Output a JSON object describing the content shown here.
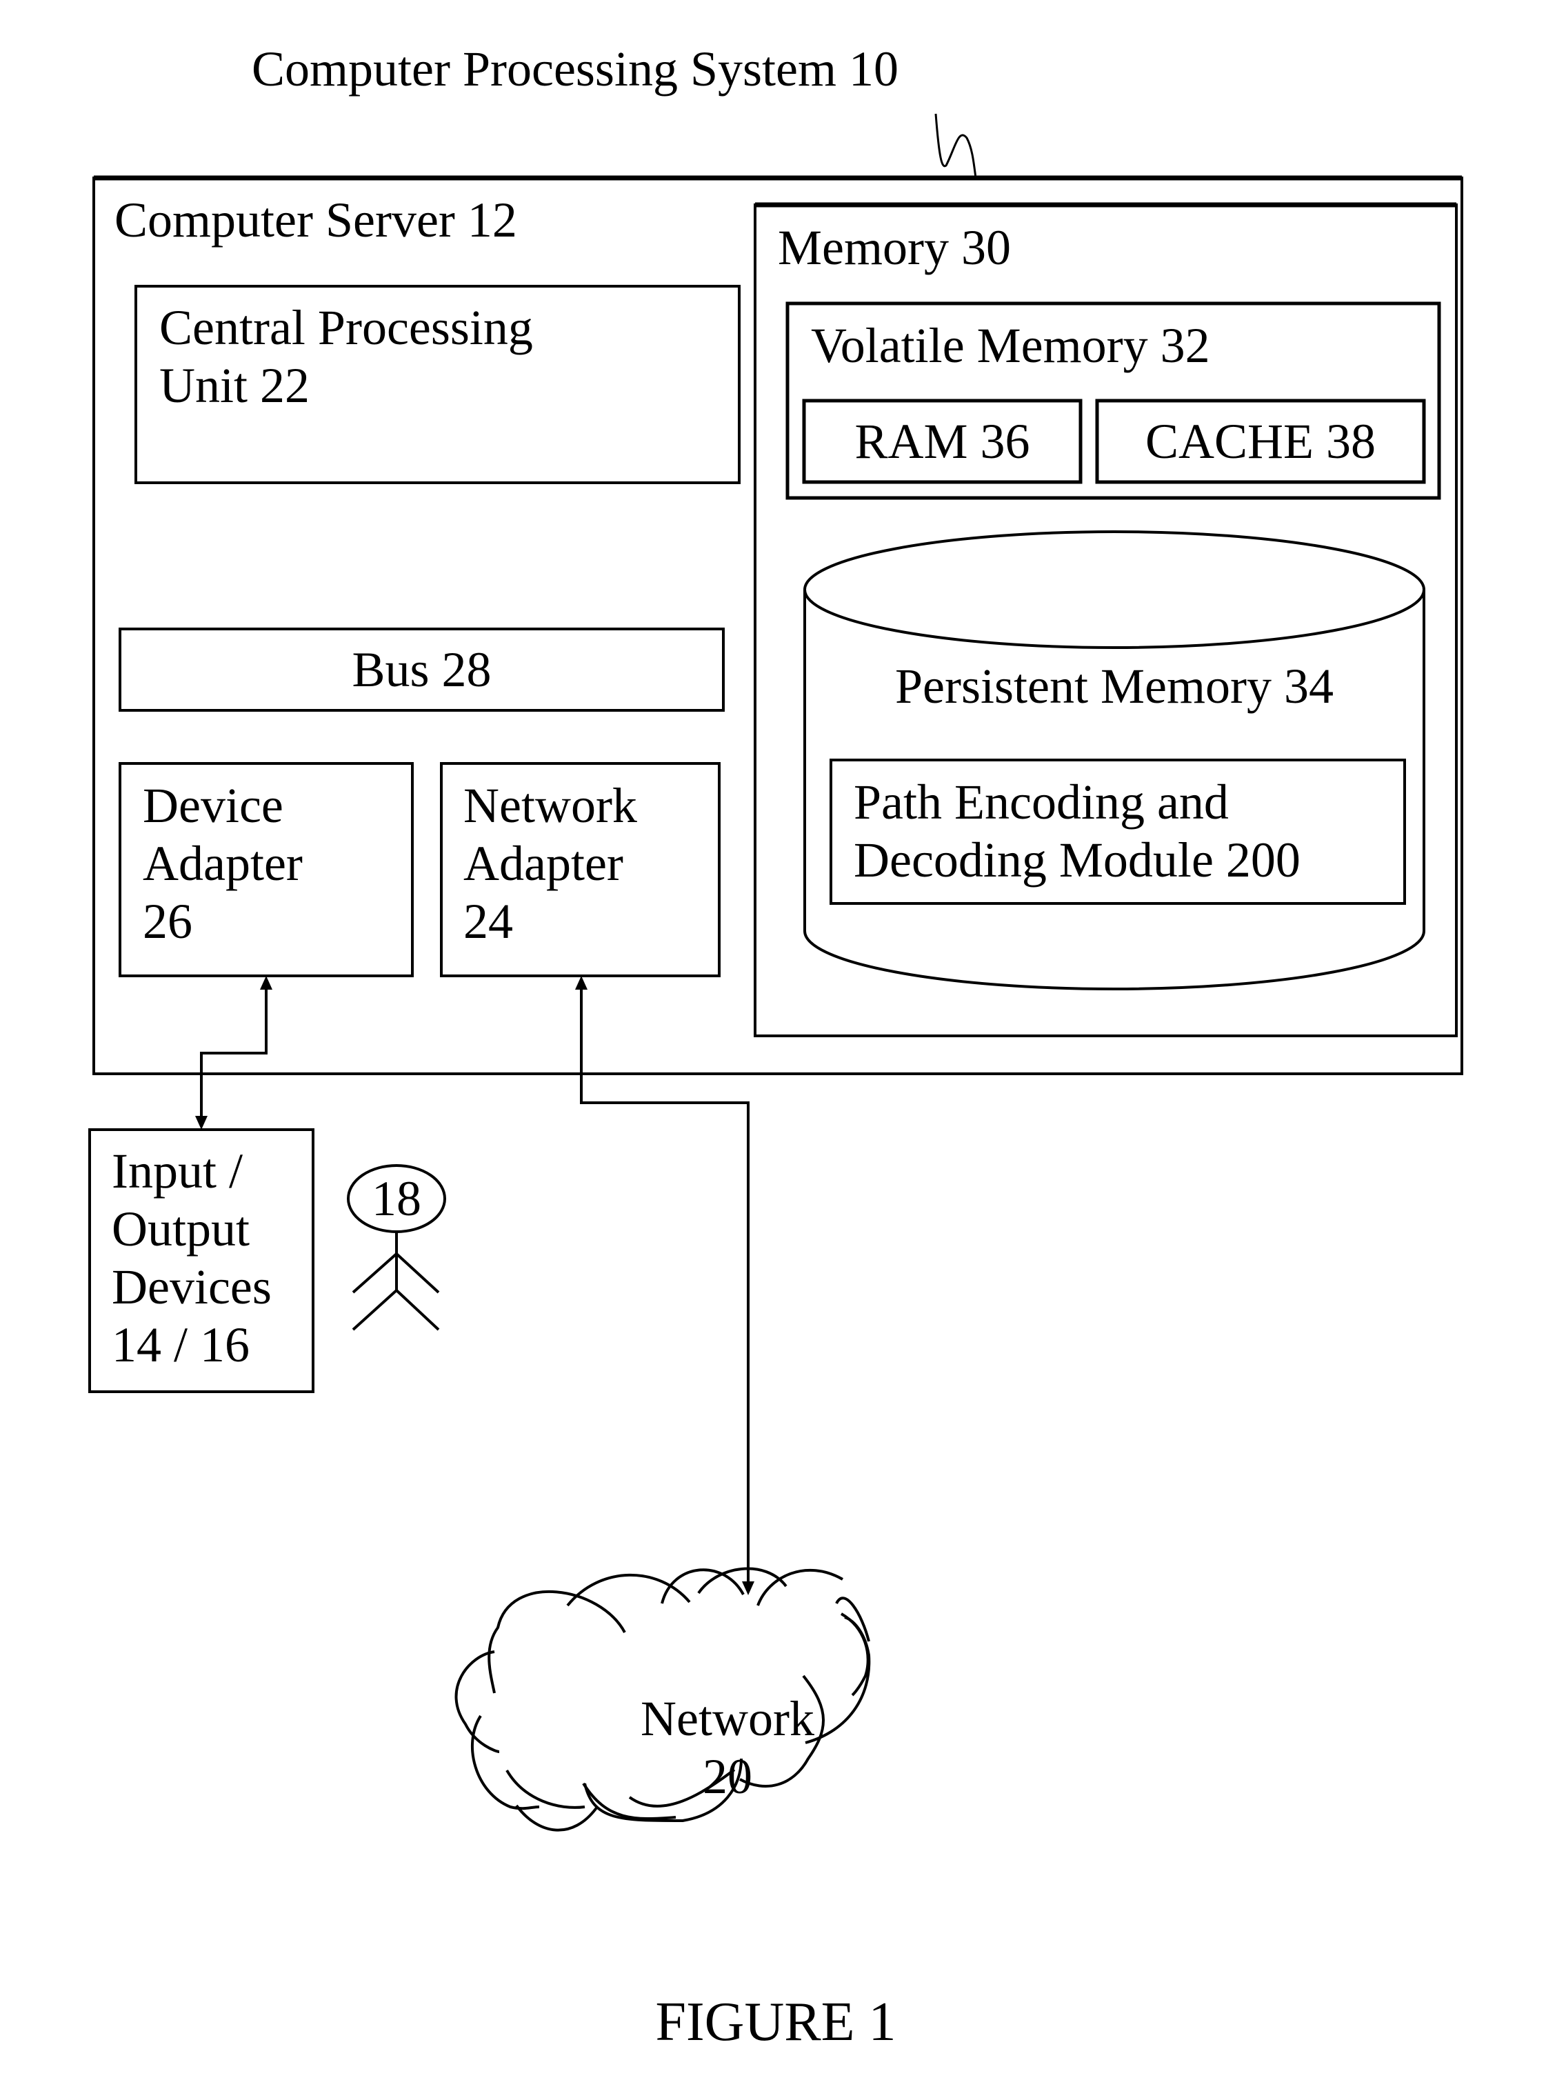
{
  "diagram": {
    "title": "Computer Processing System 10",
    "server": {
      "label": "Computer Server 12"
    },
    "cpu": {
      "line1": "Central Processing",
      "line2": "Unit 22"
    },
    "bus": {
      "label": "Bus 28"
    },
    "device_adapter": {
      "line1": "Device",
      "line2": "Adapter",
      "line3": "26"
    },
    "network_adapter": {
      "line1": "Network",
      "line2": "Adapter",
      "line3": "24"
    },
    "memory": {
      "label": "Memory 30"
    },
    "volatile_memory": {
      "label": "Volatile Memory 32"
    },
    "ram": {
      "label": "RAM 36"
    },
    "cache": {
      "label": "CACHE 38"
    },
    "persistent_memory": {
      "label": "Persistent Memory 34"
    },
    "module": {
      "line1": "Path Encoding and",
      "line2": "Decoding Module 200"
    },
    "io_devices": {
      "line1": "Input /",
      "line2": "Output",
      "line3": "Devices",
      "line4": "14 / 16"
    },
    "user": {
      "label": "18"
    },
    "network": {
      "line1": "Network",
      "line2": "20"
    },
    "caption": "FIGURE 1"
  }
}
